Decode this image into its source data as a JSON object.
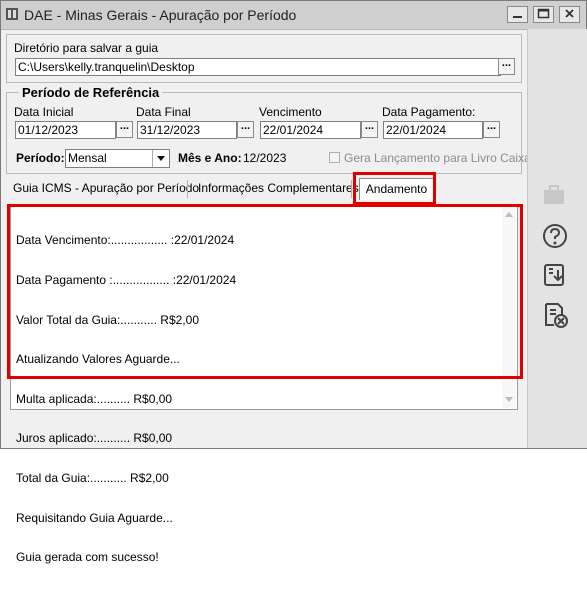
{
  "window": {
    "title": "DAE - Minas Gerais - Apuração por Período",
    "buttons": [
      "minimize-icon",
      "maximize-icon",
      "close-icon"
    ]
  },
  "directory": {
    "label": "Diretório para salvar a guia",
    "value": "C:\\Users\\kelly.tranquelin\\Desktop",
    "browse_label": "..."
  },
  "reference_period": {
    "title": "Período de Referência",
    "data_inicial_label": "Data Inicial",
    "data_inicial": "01/12/2023",
    "data_final_label": "Data Final",
    "data_final": "31/12/2023",
    "vencimento_label": "Vencimento",
    "vencimento": "22/01/2024",
    "data_pagamento_label": "Data Pagamento:",
    "data_pagamento": "22/01/2024",
    "periodo_label": "Período:",
    "periodo_value": "Mensal",
    "mes_ano_label": "Mês e Ano:",
    "mes_ano_value": "12/2023",
    "livro_caixa_label": "Gera Lançamento para Livro Caixa?"
  },
  "tabs": [
    {
      "label": "Guia ICMS - Apuração por Período"
    },
    {
      "label": "Informações Complementares"
    },
    {
      "label": "Andamento"
    }
  ],
  "progress_log": [
    "Data Vencimento:................. :22/01/2024",
    "Data Pagamento :................. :22/01/2024",
    "Valor Total da Guia:........... R$2,00",
    "Atualizando Valores Aguarde...",
    "Multa aplicada:.......... R$0,00",
    "Juros aplicado:.......... R$0,00",
    "Total da Guia:........... R$2,00",
    "Requisitando Guia Aguarde...",
    "Guia gerada com sucesso!"
  ],
  "sidebar_icons": [
    "briefcase-icon",
    "help-icon",
    "download-report-icon",
    "cancel-document-icon"
  ],
  "colors": {
    "highlight": "#e00000",
    "titlebar": "#cfcfcf",
    "window_bg": "#f0f0f0"
  }
}
